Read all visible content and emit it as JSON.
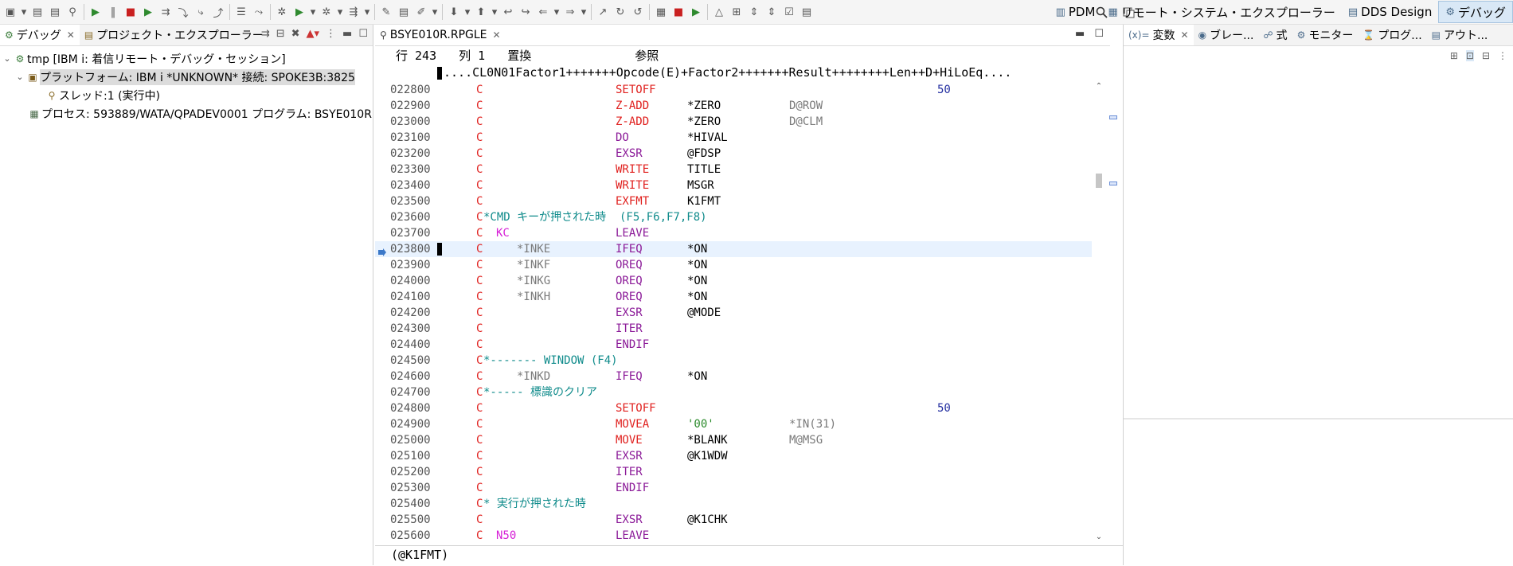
{
  "toolbar": {
    "perspectives": [
      {
        "label": "PDM",
        "active": false
      },
      {
        "label": "リモート・システム・エクスプローラー",
        "active": false
      },
      {
        "label": "DDS Design",
        "active": false
      },
      {
        "label": "デバッグ",
        "active": true
      }
    ]
  },
  "left_view": {
    "tabs": [
      {
        "label": "デバッグ",
        "active": true
      },
      {
        "label": "プロジェクト・エクスプローラー",
        "active": false
      }
    ],
    "tree": [
      {
        "label": "tmp [IBM i: 着信リモート・デバッグ・セッション]",
        "level": 0,
        "expanded": true
      },
      {
        "label": "プラットフォーム: IBM i *UNKNOWN*   接続: SPOKE3B:3825",
        "level": 1,
        "expanded": true,
        "selected": true
      },
      {
        "label": "スレッド:1 (実行中)",
        "level": 2
      },
      {
        "label": "プロセス: 593889/WATA/QPADEV0001  プログラム: BSYE010R",
        "level": 1
      }
    ]
  },
  "editor": {
    "tab_label": "BSYE010R.RPGLE",
    "status": {
      "row": "行 243",
      "col": "列 1",
      "mode": "置換",
      "ref": "参照"
    },
    "ruler": "....CL0N01Factor1+++++++Opcode(E)+Factor2+++++++Result++++++++Len++D+HiLoEq....",
    "lines": [
      {
        "num": "022800",
        "c": "C",
        "op": "SETOFF",
        "ind": "50"
      },
      {
        "num": "022900",
        "c": "C",
        "op": "Z-ADD",
        "f2": "*ZERO",
        "res": "D@ROW"
      },
      {
        "num": "023000",
        "c": "C",
        "op": "Z-ADD",
        "f2": "*ZERO",
        "res": "D@CLM"
      },
      {
        "num": "023100",
        "c": "C",
        "op": "DO",
        "f2": "*HIVAL",
        "op_color": "purple"
      },
      {
        "num": "023200",
        "c": "C",
        "op": "EXSR",
        "f2": "@FDSP",
        "op_color": "purple"
      },
      {
        "num": "023300",
        "c": "C",
        "op": "WRITE",
        "f2": "TITLE"
      },
      {
        "num": "023400",
        "c": "C",
        "op": "WRITE",
        "f2": "MSGR"
      },
      {
        "num": "023500",
        "c": "C",
        "op": "EXFMT",
        "f2": "K1FMT"
      },
      {
        "num": "023600",
        "c": "C",
        "comment": "*CMD キーが押された時  (F5,F6,F7,F8)"
      },
      {
        "num": "023700",
        "c": "C",
        "cond": "KC",
        "op": "LEAVE",
        "op_color": "purple"
      },
      {
        "num": "023800",
        "c": "C",
        "f1": "*INKE",
        "op": "IFEQ",
        "f2": "*ON",
        "op_color": "purple",
        "current": true
      },
      {
        "num": "023900",
        "c": "C",
        "f1": "*INKF",
        "op": "OREQ",
        "f2": "*ON",
        "op_color": "purple"
      },
      {
        "num": "024000",
        "c": "C",
        "f1": "*INKG",
        "op": "OREQ",
        "f2": "*ON",
        "op_color": "purple"
      },
      {
        "num": "024100",
        "c": "C",
        "f1": "*INKH",
        "op": "OREQ",
        "f2": "*ON",
        "op_color": "purple"
      },
      {
        "num": "024200",
        "c": "C",
        "op": "EXSR",
        "f2": "@MODE",
        "op_color": "purple"
      },
      {
        "num": "024300",
        "c": "C",
        "op": "ITER",
        "op_color": "purple"
      },
      {
        "num": "024400",
        "c": "C",
        "op": "ENDIF",
        "op_color": "purple"
      },
      {
        "num": "024500",
        "c": "C",
        "comment": "*------- WINDOW (F4)"
      },
      {
        "num": "024600",
        "c": "C",
        "f1": "*INKD",
        "op": "IFEQ",
        "f2": "*ON",
        "op_color": "purple"
      },
      {
        "num": "024700",
        "c": "C",
        "comment": "*----- 標識のクリア"
      },
      {
        "num": "024800",
        "c": "C",
        "op": "SETOFF",
        "ind": "50"
      },
      {
        "num": "024900",
        "c": "C",
        "op": "MOVEA",
        "f2": "'00'",
        "res": "*IN(31)",
        "f2_color": "green"
      },
      {
        "num": "025000",
        "c": "C",
        "op": "MOVE",
        "f2": "*BLANK",
        "res": "M@MSG"
      },
      {
        "num": "025100",
        "c": "C",
        "op": "EXSR",
        "f2": "@K1WDW",
        "op_color": "purple"
      },
      {
        "num": "025200",
        "c": "C",
        "op": "ITER",
        "op_color": "purple"
      },
      {
        "num": "025300",
        "c": "C",
        "op": "ENDIF",
        "op_color": "purple"
      },
      {
        "num": "025400",
        "c": "C",
        "comment": "* 実行が押された時"
      },
      {
        "num": "025500",
        "c": "C",
        "op": "EXSR",
        "f2": "@K1CHK",
        "op_color": "purple"
      },
      {
        "num": "025600",
        "c": "C",
        "cond": "N50",
        "op": "LEAVE",
        "op_color": "purple"
      }
    ],
    "bottom_text": "(@K1FMT)"
  },
  "right_view": {
    "tabs": [
      {
        "label": "変数",
        "active": true,
        "icon": "variables-icon"
      },
      {
        "label": "ブレー...",
        "active": false,
        "icon": "breakpoints-icon"
      },
      {
        "label": "式",
        "active": false,
        "icon": "expressions-icon"
      },
      {
        "label": "モニター",
        "active": false,
        "icon": "monitor-icon"
      },
      {
        "label": "プログ...",
        "active": false,
        "icon": "program-icon"
      },
      {
        "label": "アウト...",
        "active": false,
        "icon": "outline-icon"
      }
    ]
  }
}
